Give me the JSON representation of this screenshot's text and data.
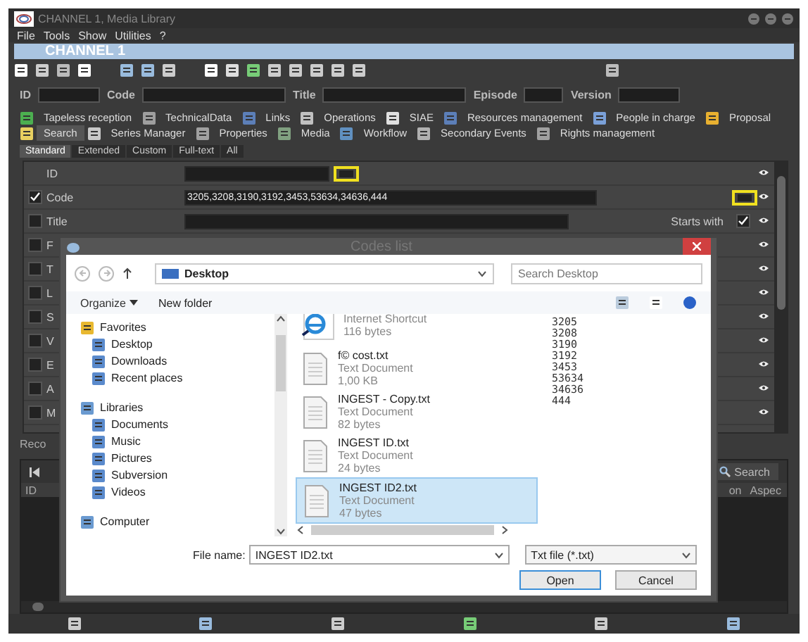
{
  "window": {
    "title": "CHANNEL 1, Media Library"
  },
  "menu": [
    "File",
    "Tools",
    "Show",
    "Utilities",
    "?"
  ],
  "channel": "CHANNEL 1",
  "header_fields": [
    {
      "label": "ID"
    },
    {
      "label": "Code"
    },
    {
      "label": "Title"
    },
    {
      "label": "Episode"
    },
    {
      "label": "Version"
    }
  ],
  "tabs_row1": [
    {
      "label": "Tapeless reception",
      "color": "#4caf50"
    },
    {
      "label": "TechnicalData",
      "color": "#9e9e9e"
    },
    {
      "label": "Links",
      "color": "#5c7fb8"
    },
    {
      "label": "Operations",
      "color": "#c0c0c0"
    },
    {
      "label": "SIAE",
      "color": "#e0e0e0"
    },
    {
      "label": "Resources management",
      "color": "#5c7fb8"
    },
    {
      "label": "People in charge",
      "color": "#7aa0d8"
    },
    {
      "label": "Proposal",
      "color": "#e8b030"
    }
  ],
  "tabs_row2": [
    {
      "label": "Search",
      "selected": true,
      "color": "#e8d060"
    },
    {
      "label": "Series Manager",
      "selected": false,
      "color": "#c8c8c8"
    },
    {
      "label": "Properties",
      "selected": false,
      "color": "#a0a0a0"
    },
    {
      "label": "Media",
      "selected": false,
      "color": "#80a080"
    },
    {
      "label": "Workflow",
      "selected": false,
      "color": "#6090c0"
    },
    {
      "label": "Secondary Events",
      "selected": false,
      "color": "#b0b0b0"
    },
    {
      "label": "Rights management",
      "selected": false,
      "color": "#a0a0a0"
    }
  ],
  "subtabs": [
    {
      "label": "Standard",
      "selected": true
    },
    {
      "label": "Extended",
      "selected": false
    },
    {
      "label": "Custom",
      "selected": false
    },
    {
      "label": "Full-text",
      "selected": false
    },
    {
      "label": "All",
      "selected": false
    }
  ],
  "criteria": [
    {
      "kind": "plain",
      "label": "ID",
      "highlighted": true
    },
    {
      "kind": "check",
      "label": "Code",
      "checked": true,
      "value": "3205,3208,3190,3192,3453,53634,34636,444",
      "highlighted": true
    },
    {
      "kind": "check",
      "label": "Title",
      "checked": false,
      "option": "Starts with",
      "option_checked": true
    },
    {
      "kind": "check",
      "label": "F",
      "checked": false
    },
    {
      "kind": "check",
      "label": "T",
      "checked": false
    },
    {
      "kind": "check",
      "label": "L",
      "checked": false
    },
    {
      "kind": "check",
      "label": "S",
      "checked": false
    },
    {
      "kind": "check",
      "label": "V",
      "checked": false
    },
    {
      "kind": "check",
      "label": "E",
      "checked": false
    },
    {
      "kind": "check",
      "label": "A",
      "checked": false
    },
    {
      "kind": "check",
      "label": "M",
      "checked": false
    }
  ],
  "records_label": "Reco",
  "results": {
    "search_button": "Search",
    "columns": [
      "ID",
      "on",
      "Aspec"
    ]
  },
  "dialog": {
    "title": "Codes list",
    "path": "Desktop",
    "search_placeholder": "Search Desktop",
    "organize": "Organize",
    "new_folder": "New folder",
    "nav": [
      {
        "label": "Favorites",
        "children": [
          {
            "label": "Desktop"
          },
          {
            "label": "Downloads"
          },
          {
            "label": "Recent places"
          }
        ]
      },
      {
        "label": "Libraries",
        "children": [
          {
            "label": "Documents"
          },
          {
            "label": "Music"
          },
          {
            "label": "Pictures"
          },
          {
            "label": "Subversion"
          },
          {
            "label": "Videos"
          }
        ]
      },
      {
        "label": "Computer"
      }
    ],
    "files": [
      {
        "kind": "shortcut",
        "type": "Internet Shortcut",
        "size": "116 bytes",
        "selected": false
      },
      {
        "kind": "text",
        "name": "f© cost.txt",
        "type": "Text Document",
        "size": "1,00 KB",
        "selected": false
      },
      {
        "kind": "text",
        "name": "INGEST - Copy.txt",
        "type": "Text Document",
        "size": "82 bytes",
        "selected": false
      },
      {
        "kind": "text",
        "name": "INGEST ID.txt",
        "type": "Text Document",
        "size": "24 bytes",
        "selected": false
      },
      {
        "kind": "text",
        "name": "INGEST ID2.txt",
        "type": "Text Document",
        "size": "47 bytes",
        "selected": true
      }
    ],
    "preview": [
      "3205",
      "3208",
      "3190",
      "3192",
      "3453",
      "53634",
      "34636",
      "444"
    ],
    "file_name_label": "File name:",
    "file_name": "INGEST ID2.txt",
    "file_type": "Txt file (*.txt)",
    "buttons": [
      "Open",
      "Cancel"
    ]
  }
}
